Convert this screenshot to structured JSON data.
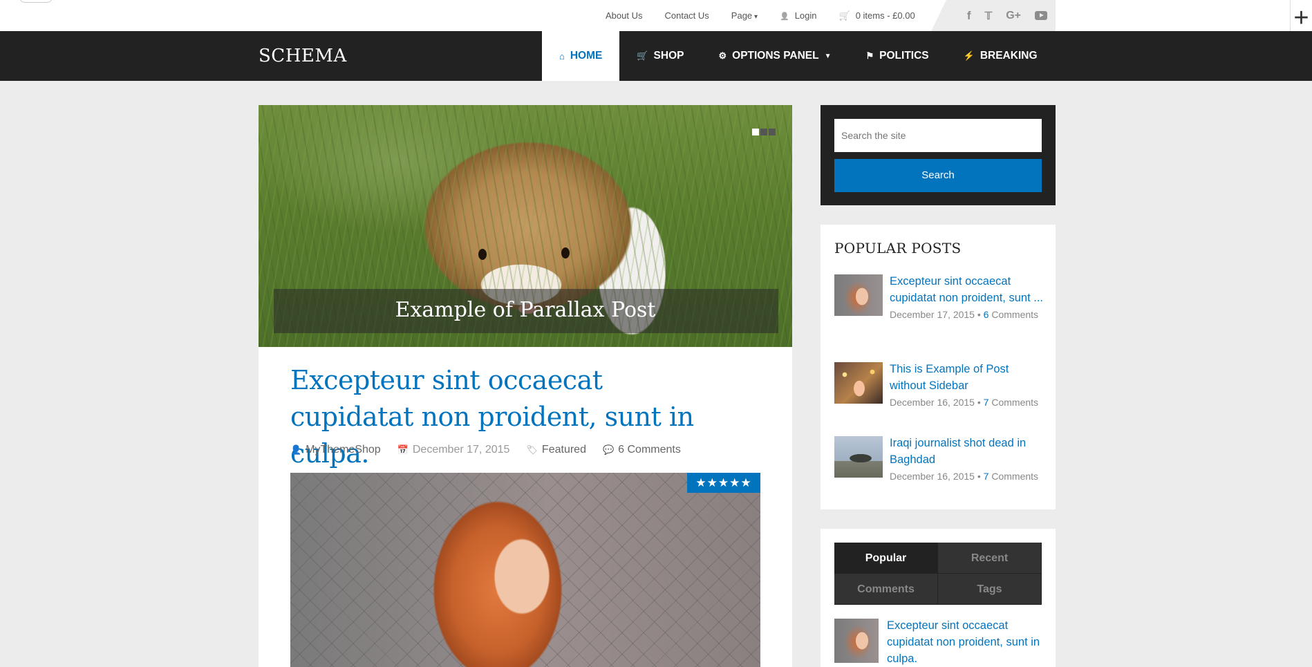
{
  "topbar": {
    "links": [
      "About Us",
      "Contact Us"
    ],
    "page_menu": "Page",
    "login": "Login",
    "cart": "0 items - £0.00",
    "social_icons": [
      "facebook-icon",
      "twitter-icon",
      "google-plus-icon",
      "youtube-icon"
    ]
  },
  "header": {
    "logo": "SCHEMA",
    "nav": [
      {
        "label": "HOME",
        "icon": "home-icon",
        "active": true
      },
      {
        "label": "SHOP",
        "icon": "cart-icon"
      },
      {
        "label": "OPTIONS PANEL",
        "icon": "cogs-icon",
        "dropdown": true
      },
      {
        "label": "POLITICS",
        "icon": "flag-icon"
      },
      {
        "label": "BREAKING",
        "icon": "bolt-icon"
      }
    ]
  },
  "slider": {
    "caption": "Example of Parallax Post",
    "dots": 3,
    "active_dot": 1
  },
  "post": {
    "title": "Excepteur sint occaecat cupidatat non proident, sunt in culpa.",
    "author": "MyThemeShop",
    "date": "December 17, 2015",
    "category": "Featured",
    "comments": "6 Comments",
    "rating": "★★★★★"
  },
  "sidebar": {
    "search": {
      "placeholder": "Search the site",
      "button": "Search"
    },
    "popular": {
      "title": "POPULAR POSTS",
      "items": [
        {
          "title": "Excepteur sint occaecat cupidatat non proident, sunt ...",
          "date": "December 17, 2015",
          "comments": "6",
          "comments_label": "Comments"
        },
        {
          "title": "This is Example of Post without Sidebar",
          "date": "December 16, 2015",
          "comments": "7",
          "comments_label": "Comments"
        },
        {
          "title": "Iraqi journalist shot dead in Baghdad",
          "date": "December 16, 2015",
          "comments": "7",
          "comments_label": "Comments"
        }
      ]
    },
    "tabs": {
      "labels": [
        "Popular",
        "Recent",
        "Comments",
        "Tags"
      ],
      "active": "Popular",
      "first_item": "Excepteur sint occaecat cupidatat non proident, sunt in culpa."
    }
  },
  "colors": {
    "accent": "#0274be",
    "dark": "#222222",
    "background": "#ececec"
  }
}
